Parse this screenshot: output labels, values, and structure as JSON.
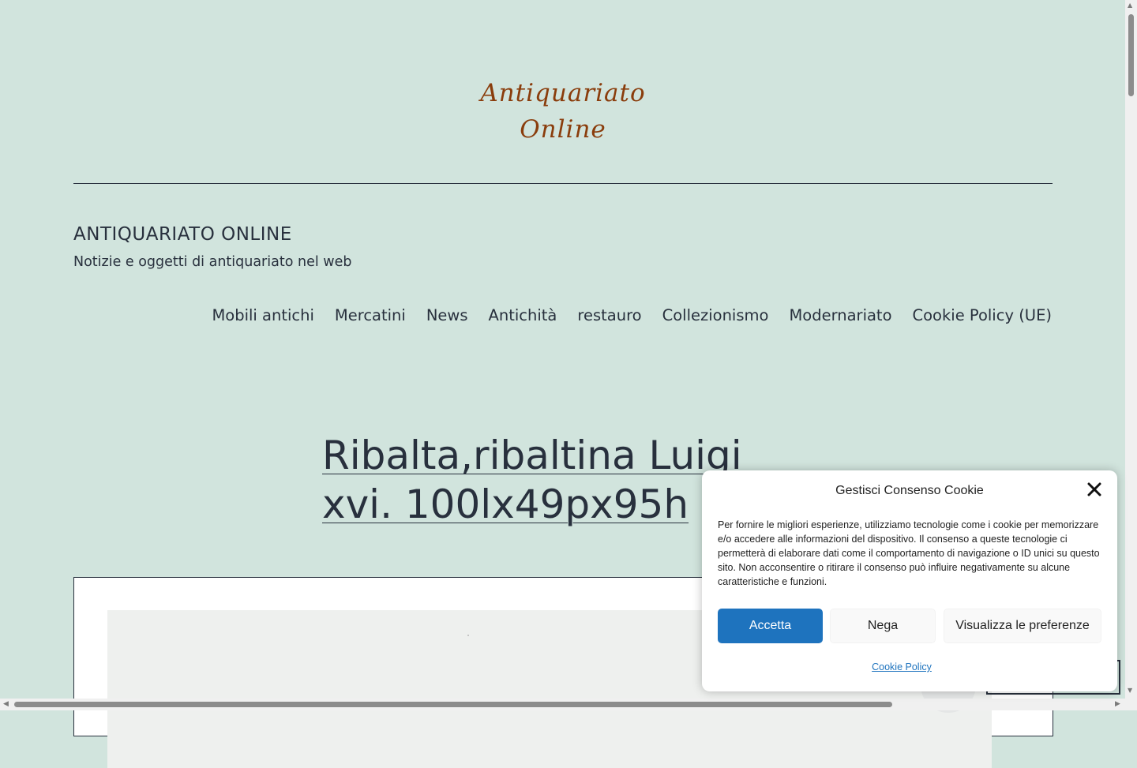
{
  "logo": {
    "line1": "Antiquariato",
    "line2": "Online"
  },
  "site": {
    "title": "ANTIQUARIATO ONLINE",
    "tagline": "Notizie e oggetti di antiquariato nel web"
  },
  "nav": {
    "items": [
      {
        "label": "Mobili antichi"
      },
      {
        "label": "Mercatini"
      },
      {
        "label": "News"
      },
      {
        "label": "Antichità"
      },
      {
        "label": "restauro"
      },
      {
        "label": "Collezionismo"
      },
      {
        "label": "Modernariato"
      },
      {
        "label": "Cookie Policy (UE)"
      }
    ]
  },
  "post": {
    "title_line1": "Ribalta,ribaltina Luigi",
    "title_line2": "xvi. 100lx49px95h"
  },
  "cookie": {
    "title": "Gestisci Consenso Cookie",
    "text": "Per fornire le migliori esperienze, utilizziamo tecnologie come i cookie per memorizzare e/o accedere alle informazioni del dispositivo. Il consenso a queste tecnologie ci permetterà di elaborare dati come il comportamento di navigazione o ID unici su questo sito. Non acconsentire o ritirare il consenso può influire negativamente su alcune caratteristiche e funzioni.",
    "accept_label": "Accetta",
    "deny_label": "Nega",
    "prefs_label": "Visualizza le preferenze",
    "policy_link": "Cookie Policy"
  },
  "colors": {
    "background": "#d1e4dd",
    "text": "#28303d",
    "logo": "#8a3d0c",
    "accent": "#1e73be"
  }
}
